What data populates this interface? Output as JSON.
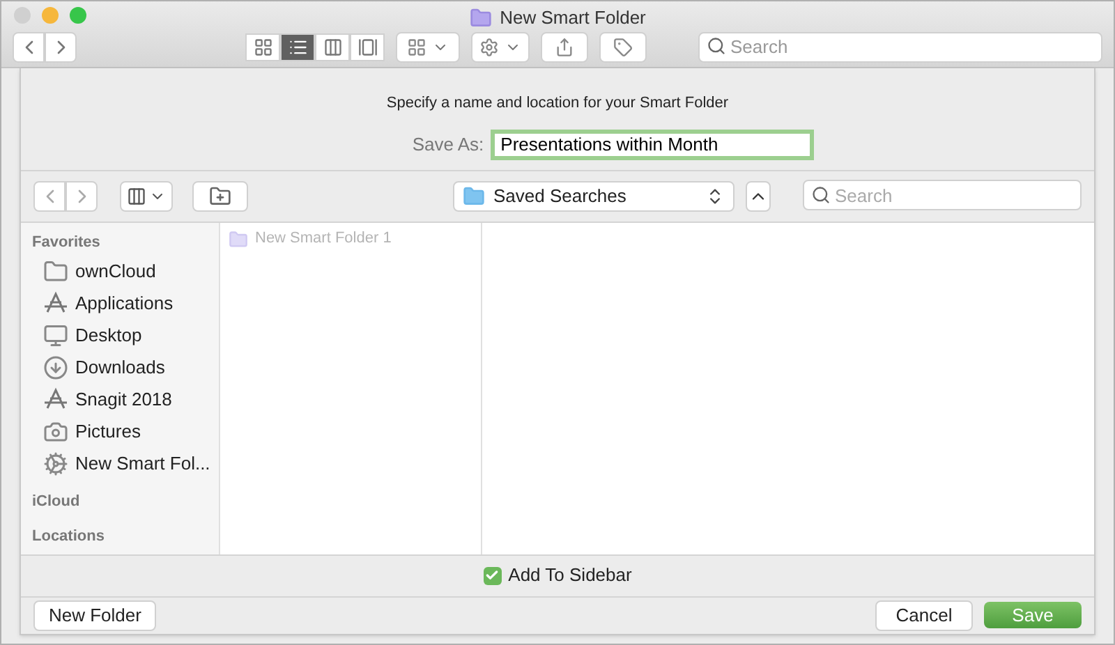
{
  "window": {
    "title": "New Smart Folder"
  },
  "toolbar": {
    "view_buttons": [
      {
        "kind": "icons",
        "selected": false
      },
      {
        "kind": "list",
        "selected": true
      },
      {
        "kind": "columns",
        "selected": false
      },
      {
        "kind": "gallery",
        "selected": false
      }
    ],
    "search": {
      "placeholder": "Search"
    }
  },
  "sheet": {
    "prompt": "Specify a name and location for your Smart Folder",
    "save_as_label": "Save As:",
    "save_as_value": "Presentations within Month",
    "location": "Saved Searches",
    "search": {
      "placeholder": "Search"
    },
    "sidebar": [
      {
        "heading": "Favorites",
        "items": [
          {
            "label": "ownCloud",
            "kind": "folder"
          },
          {
            "label": "Applications",
            "kind": "apps"
          },
          {
            "label": "Desktop",
            "kind": "desktop"
          },
          {
            "label": "Downloads",
            "kind": "downloads"
          },
          {
            "label": "Snagit 2018",
            "kind": "apps"
          },
          {
            "label": "Pictures",
            "kind": "camera"
          },
          {
            "label": "New Smart Fol...",
            "kind": "gear"
          }
        ]
      },
      {
        "heading": "iCloud"
      },
      {
        "heading": "Locations"
      }
    ],
    "files": [
      {
        "label": "New Smart Folder 1",
        "disabled": true
      }
    ],
    "add_to_sidebar": {
      "label": "Add To Sidebar",
      "checked": true
    },
    "buttons": {
      "new_folder": "New Folder",
      "cancel": "Cancel",
      "save": "Save"
    }
  }
}
